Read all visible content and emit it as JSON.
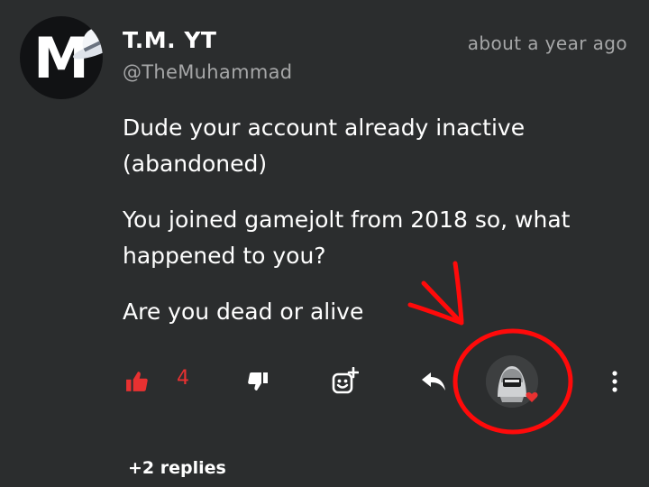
{
  "comment": {
    "avatar": {
      "letter": "M",
      "icon": "fedora-hat-icon"
    },
    "display_name": "T.M. YT",
    "username": "@TheMuhammad",
    "timestamp": "about a year ago",
    "paragraphs": [
      "Dude your account already inactive (abandoned)",
      "You joined gamejolt from 2018 so, what happened to you?",
      "Are you dead or alive"
    ]
  },
  "actions": {
    "like": {
      "icon": "thumbs-up-icon",
      "count": "4",
      "active_color": "#e83131"
    },
    "dislike": {
      "icon": "thumbs-down-icon"
    },
    "add_reaction": {
      "icon": "add-emoji-icon"
    },
    "reply": {
      "icon": "reply-arrow-icon"
    },
    "reaction": {
      "icon": "hooded-character-avatar",
      "badge": "heart-icon",
      "badge_color": "#e83131"
    },
    "more": {
      "icon": "more-vertical-icon"
    }
  },
  "replies": {
    "label": "+2 replies"
  },
  "annotation": {
    "color": "#ff0a0a",
    "shapes": [
      "arrow",
      "circle"
    ]
  },
  "colors": {
    "background": "#2b2d2e",
    "text_primary": "#ffffff",
    "text_secondary": "#a6a7a8",
    "accent": "#e83131"
  }
}
